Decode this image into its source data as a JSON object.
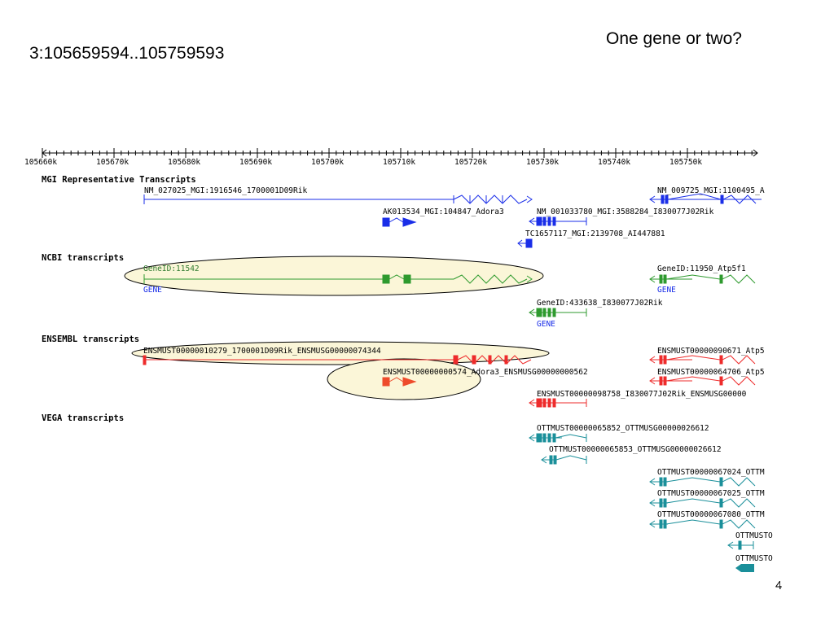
{
  "slide": {
    "title": "One gene or two?",
    "coordinates": "3:105659594..105759593",
    "page_number": "4"
  },
  "ruler": {
    "ticks": [
      "105660k",
      "105670k",
      "105680k",
      "105690k",
      "105700k",
      "105710k",
      "105720k",
      "105730k",
      "105740k",
      "105750k"
    ]
  },
  "tracks": {
    "mgi": {
      "title": "MGI Representative Transcripts",
      "labels": [
        "NM_027025_MGI:1916546_1700001D09Rik",
        "NM_009725_MGI:1100495_A",
        "AK013534_MGI:104847_Adora3",
        "NM_001033780_MGI:3588284_I830077J02Rik",
        "TC1657117_MGI:2139708_AI447881"
      ]
    },
    "ncbi": {
      "title": "NCBI transcripts",
      "labels": [
        "GeneID:11542",
        "GENE",
        "GeneID:11950_Atp5f1",
        "GENE",
        "GeneID:433638_I830077J02Rik",
        "GENE"
      ]
    },
    "ensembl": {
      "title": "ENSEMBL transcripts",
      "labels": [
        "ENSMUST00000010279_1700001D09Rik_ENSMUSG00000074344",
        "ENSMUST00000090671_Atp5",
        "ENSMUST00000000574_Adora3_ENSMUSG00000000562",
        "ENSMUST00000064706_Atp5",
        "ENSMUST00000098758_I830077J02Rik_ENSMUSG00000"
      ]
    },
    "vega": {
      "title": "VEGA transcripts",
      "labels": [
        "OTTMUST00000065852_OTTMUSG00000026612",
        "OTTMUST00000065853_OTTMUSG00000026612",
        "OTTMUST00000067024_OTTM",
        "OTTMUST00000067025_OTTM",
        "OTTMUST00000067080_OTTM",
        "OTTMUSTO",
        "OTTMUSTO"
      ]
    }
  },
  "colors": {
    "mgi": "#1a2ee8",
    "ncbi": "#2e9a2e",
    "ensembl": "#ee2b2b",
    "vega": "#1a8f9a",
    "highlight_fill": "#fbf6d8"
  }
}
